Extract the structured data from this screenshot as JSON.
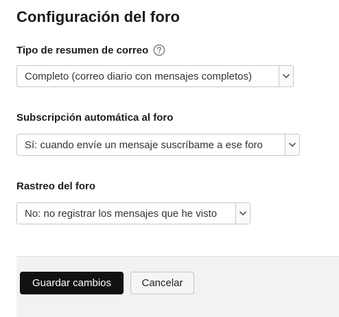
{
  "form": {
    "title": "Configuración del foro",
    "fields": [
      {
        "label": "Tipo de resumen de correo",
        "has_help": true,
        "help_icon": "question-circle-icon",
        "selected": "Completo (correo diario con mensajes completos)"
      },
      {
        "label": "Subscripción automática al foro",
        "has_help": false,
        "selected": "Sí: cuando envíe un mensaje suscríbame a ese foro"
      },
      {
        "label": "Rastreo del foro",
        "has_help": false,
        "selected": "No: no registrar los mensajes que he visto"
      }
    ]
  },
  "actions": {
    "save_label": "Guardar cambios",
    "cancel_label": "Cancelar"
  },
  "colors": {
    "primary_button": "#111111",
    "footer_background": "#f2f2f2",
    "select_border": "#c8c8c8"
  }
}
